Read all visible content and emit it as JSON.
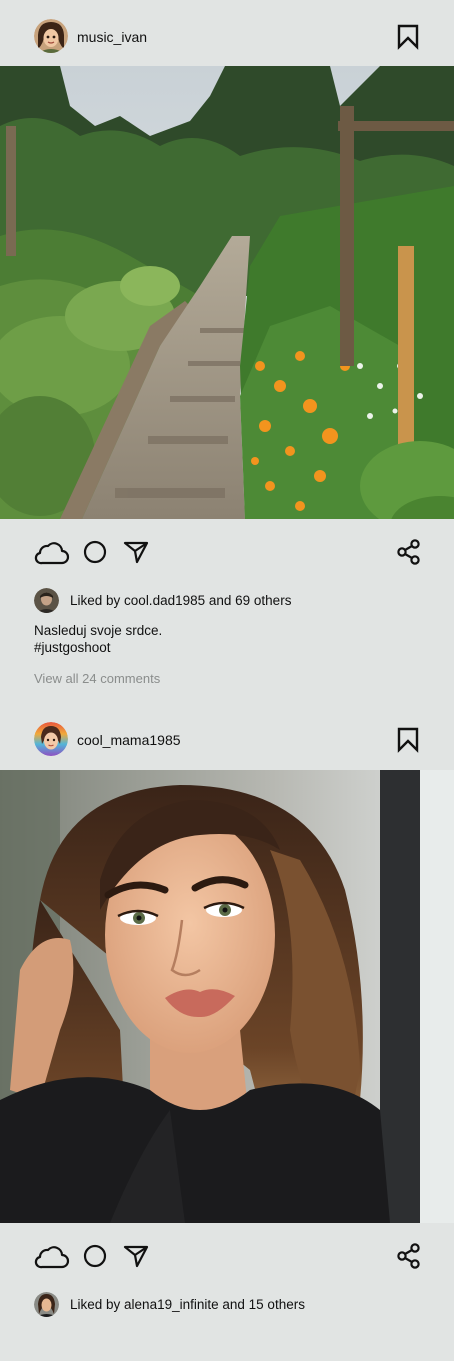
{
  "posts": [
    {
      "username": "music_ivan",
      "media_description": "garden",
      "liked_by_prefix": "Liked by ",
      "liked_by_user": "cool.dad1985",
      "liked_by_suffix": " and 69 others",
      "caption_line1": "Nasleduj svoje srdce.",
      "caption_line2": "#justgoshoot",
      "comments_link": "View all 24 comments"
    },
    {
      "username": "cool_mama1985",
      "media_description": "portrait",
      "liked_by_prefix": "Liked by ",
      "liked_by_user": "alena19_infinite",
      "liked_by_suffix": " and 15 others"
    }
  ],
  "icons": {
    "like": "cloud-icon",
    "comment": "circle-icon",
    "share": "send-arrow-icon",
    "share_network": "share-network-icon",
    "bookmark": "bookmark-icon"
  },
  "colors": {
    "background": "#e1e4e3",
    "text": "#111111",
    "muted": "#8a8d8c"
  }
}
